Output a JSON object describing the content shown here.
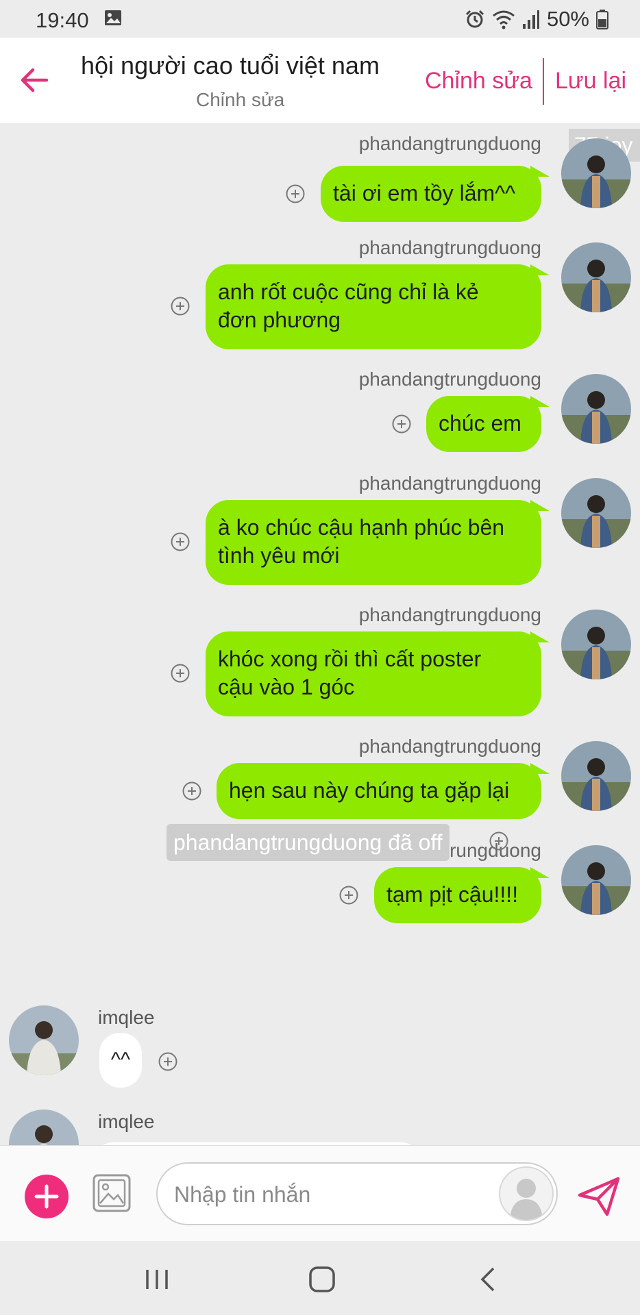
{
  "status_bar": {
    "time": "19:40",
    "battery": "50%",
    "icons": [
      "image-icon",
      "alarm-icon",
      "wifi-icon",
      "signal-icon",
      "battery-icon"
    ]
  },
  "header": {
    "title": "hội người cao tuổi việt nam",
    "subtitle": "Chỉnh sửa",
    "edit_label": "Chỉnh sửa",
    "save_label": "Lưu lại",
    "accent_color": "#e2327a"
  },
  "chat": {
    "corner_badge": "77 joy",
    "outgoing": [
      {
        "author": "phandangtrungduong",
        "lines": [
          "tài ơi em tồy lắm^^"
        ]
      },
      {
        "author": "phandangtrungduong",
        "lines": [
          "anh rốt cuộc cũng chỉ là kẻ",
          "đơn phương"
        ]
      },
      {
        "author": "phandangtrungduong",
        "lines": [
          "chúc em"
        ]
      },
      {
        "author": "phandangtrungduong",
        "lines": [
          "à ko chúc cậu hạnh phúc bên",
          "tình yêu mới"
        ]
      },
      {
        "author": "phandangtrungduong",
        "lines": [
          "khóc xong rồi thì cất poster",
          "cậu vào 1 góc"
        ]
      },
      {
        "author": "phandangtrungduong",
        "lines": [
          "hẹn sau này chúng ta gặp lại"
        ]
      },
      {
        "author": "phandangtrungduong",
        "lines": [
          "tạm pịt cậu!!!!"
        ]
      }
    ],
    "system_notice": "phandangtrungduong đã off",
    "incoming": [
      {
        "author": "imqlee",
        "text": "^^"
      },
      {
        "author": "imqlee",
        "text": ""
      }
    ],
    "bubble_color": "#8fe800"
  },
  "composer": {
    "placeholder": "Nhập tin nhắn",
    "value": ""
  }
}
